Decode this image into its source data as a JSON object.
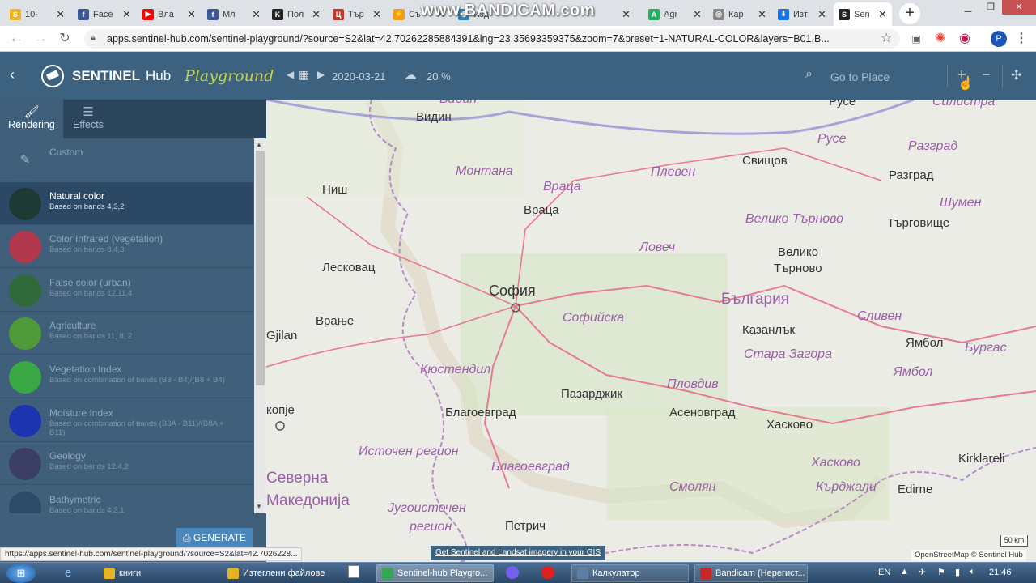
{
  "browser": {
    "tabs": [
      {
        "title": "10-",
        "icon": "S",
        "icon_color": "#f0b323"
      },
      {
        "title": "Face",
        "icon": "f",
        "icon_color": "#3b5998"
      },
      {
        "title": "Вла",
        "icon": "▶",
        "icon_color": "#ff0000"
      },
      {
        "title": "Мл",
        "icon": "f",
        "icon_color": "#3b5998"
      },
      {
        "title": "Пол",
        "icon": "K",
        "icon_color": "#222222"
      },
      {
        "title": "Тър",
        "icon": "Ц",
        "icon_color": "#c0392b"
      },
      {
        "title": "Съ",
        "icon": "⚡",
        "icon_color": "#f39c12"
      },
      {
        "title": "Изд",
        "icon": "◉",
        "icon_color": "#2980b9"
      },
      {
        "title": "Agr",
        "icon": "A",
        "icon_color": "#27ae60"
      },
      {
        "title": "Кар",
        "icon": "◎",
        "icon_color": "#888888"
      },
      {
        "title": "Изт",
        "icon": "⬇",
        "icon_color": "#1a73e8"
      },
      {
        "title": "Sen",
        "icon": "S",
        "icon_color": "#222222"
      }
    ],
    "new_tab": "+",
    "url": "apps.sentinel-hub.com/sentinel-playground/?source=S2&lat=42.70262285884391&lng=23.35693359375&zoom=7&preset=1-NATURAL-COLOR&layers=B01,B...",
    "watermark": "www.BANDICAM.com",
    "profile_letter": "P"
  },
  "header": {
    "brand": "SENTINEL",
    "brand_suffix": "Hub",
    "product": "Playground",
    "date": "2020-03-21",
    "cloud": "20 %",
    "search_placeholder": "Go to Place"
  },
  "sidebar": {
    "tabs": [
      {
        "label": "Rendering"
      },
      {
        "label": "Effects"
      }
    ],
    "layers": [
      {
        "name": "Custom",
        "desc": "",
        "color": "#3f5f7b"
      },
      {
        "name": "Natural color",
        "desc": "Based on bands 4,3,2",
        "color": "#1f3a34"
      },
      {
        "name": "Color Infrared (vegetation)",
        "desc": "Based on bands 8,4,3",
        "color": "#b2384e"
      },
      {
        "name": "False color (urban)",
        "desc": "Based on bands 12,11,4",
        "color": "#2f6a3a"
      },
      {
        "name": "Agriculture",
        "desc": "Based on bands 11, 8, 2",
        "color": "#4e9a3a"
      },
      {
        "name": "Vegetation Index",
        "desc": "Based on combination of bands (B8 - B4)/(B8 + B4)",
        "color": "#39a845"
      },
      {
        "name": "Moisture Index",
        "desc": "Based on combination of bands (B8A - B11)/(B8A + B11)",
        "color": "#1c34b0"
      },
      {
        "name": "Geology",
        "desc": "Based on bands 12,4,2",
        "color": "#3a3f63"
      },
      {
        "name": "Bathymetric",
        "desc": "Based on bands 4,3,1",
        "color": "#2d4a66"
      }
    ],
    "generate": "GENERATE"
  },
  "map": {
    "labels": [
      {
        "t": "Видин",
        "c": "reg"
      },
      {
        "t": "Видин",
        "c": "city"
      },
      {
        "t": "Монтана",
        "c": "reg"
      },
      {
        "t": "Враца",
        "c": "reg"
      },
      {
        "t": "Враца",
        "c": "city"
      },
      {
        "t": "Плевен",
        "c": "reg"
      },
      {
        "t": "Свищов",
        "c": "city"
      },
      {
        "t": "Русе",
        "c": "city"
      },
      {
        "t": "Русе",
        "c": "reg"
      },
      {
        "t": "Силистра",
        "c": "reg"
      },
      {
        "t": "Разград",
        "c": "reg"
      },
      {
        "t": "Разград",
        "c": "city"
      },
      {
        "t": "Шумен",
        "c": "reg"
      },
      {
        "t": "Ниш",
        "c": "city"
      },
      {
        "t": "Велико Търново",
        "c": "reg"
      },
      {
        "t": "Търговище",
        "c": "city"
      },
      {
        "t": "Лесковац",
        "c": "city"
      },
      {
        "t": "Ловеч",
        "c": "reg"
      },
      {
        "t": "Велико",
        "c": "city"
      },
      {
        "t": "Търново",
        "c": "city"
      },
      {
        "t": "София",
        "c": "bigcity"
      },
      {
        "t": "България",
        "c": "country"
      },
      {
        "t": "Софийска",
        "c": "reg"
      },
      {
        "t": "Сливен",
        "c": "reg"
      },
      {
        "t": "Врање",
        "c": "city"
      },
      {
        "t": "Казанлък",
        "c": "city"
      },
      {
        "t": "Gjilan",
        "c": "city"
      },
      {
        "t": "Стара Загора",
        "c": "reg"
      },
      {
        "t": "Ямбол",
        "c": "city"
      },
      {
        "t": "Бургас",
        "c": "reg"
      },
      {
        "t": "Кюстендил",
        "c": "reg"
      },
      {
        "t": "Пловдив",
        "c": "reg"
      },
      {
        "t": "Ямбол",
        "c": "reg"
      },
      {
        "t": "Пазарджик",
        "c": "city"
      },
      {
        "t": "копје",
        "c": "city"
      },
      {
        "t": "Благоевград",
        "c": "city"
      },
      {
        "t": "Асеновград",
        "c": "city"
      },
      {
        "t": "Хасково",
        "c": "city"
      },
      {
        "t": "Источен регион",
        "c": "reg"
      },
      {
        "t": "Хасково",
        "c": "reg"
      },
      {
        "t": "Kirklareli",
        "c": "city"
      },
      {
        "t": "Благоевград",
        "c": "reg"
      },
      {
        "t": "Северна",
        "c": "country"
      },
      {
        "t": "Македонија",
        "c": "country"
      },
      {
        "t": "Смолян",
        "c": "reg"
      },
      {
        "t": "Кърджали",
        "c": "reg"
      },
      {
        "t": "Edirne",
        "c": "city"
      },
      {
        "t": "Југоисточен",
        "c": "reg"
      },
      {
        "t": "регион",
        "c": "reg"
      },
      {
        "t": "Петрич",
        "c": "city"
      }
    ],
    "scale": "50 km",
    "gis_link": "Get Sentinel and Landsat imagery in your GIS",
    "attribution_osm": "OpenStreetMap",
    "attribution_sh": "© Sentinel Hub"
  },
  "status_url": "https://apps.sentinel-hub.com/sentinel-playground/?source=S2&lat=42.7026228...",
  "taskbar": {
    "items": [
      {
        "label": "книги",
        "color": "#e6b422",
        "btn": false
      },
      {
        "label": "Изтеглени файлове",
        "color": "#e6b422",
        "btn": false
      },
      {
        "label": "Sentinel-hub Playgro...",
        "color": "#34a853",
        "btn": true
      },
      {
        "label": "Калкулатор",
        "color": "#5b7fa6",
        "btn": true
      },
      {
        "label": "Bandicam (Нерегист...",
        "color": "#c62828",
        "btn": true
      }
    ],
    "lang": "EN",
    "time": "21:46"
  }
}
